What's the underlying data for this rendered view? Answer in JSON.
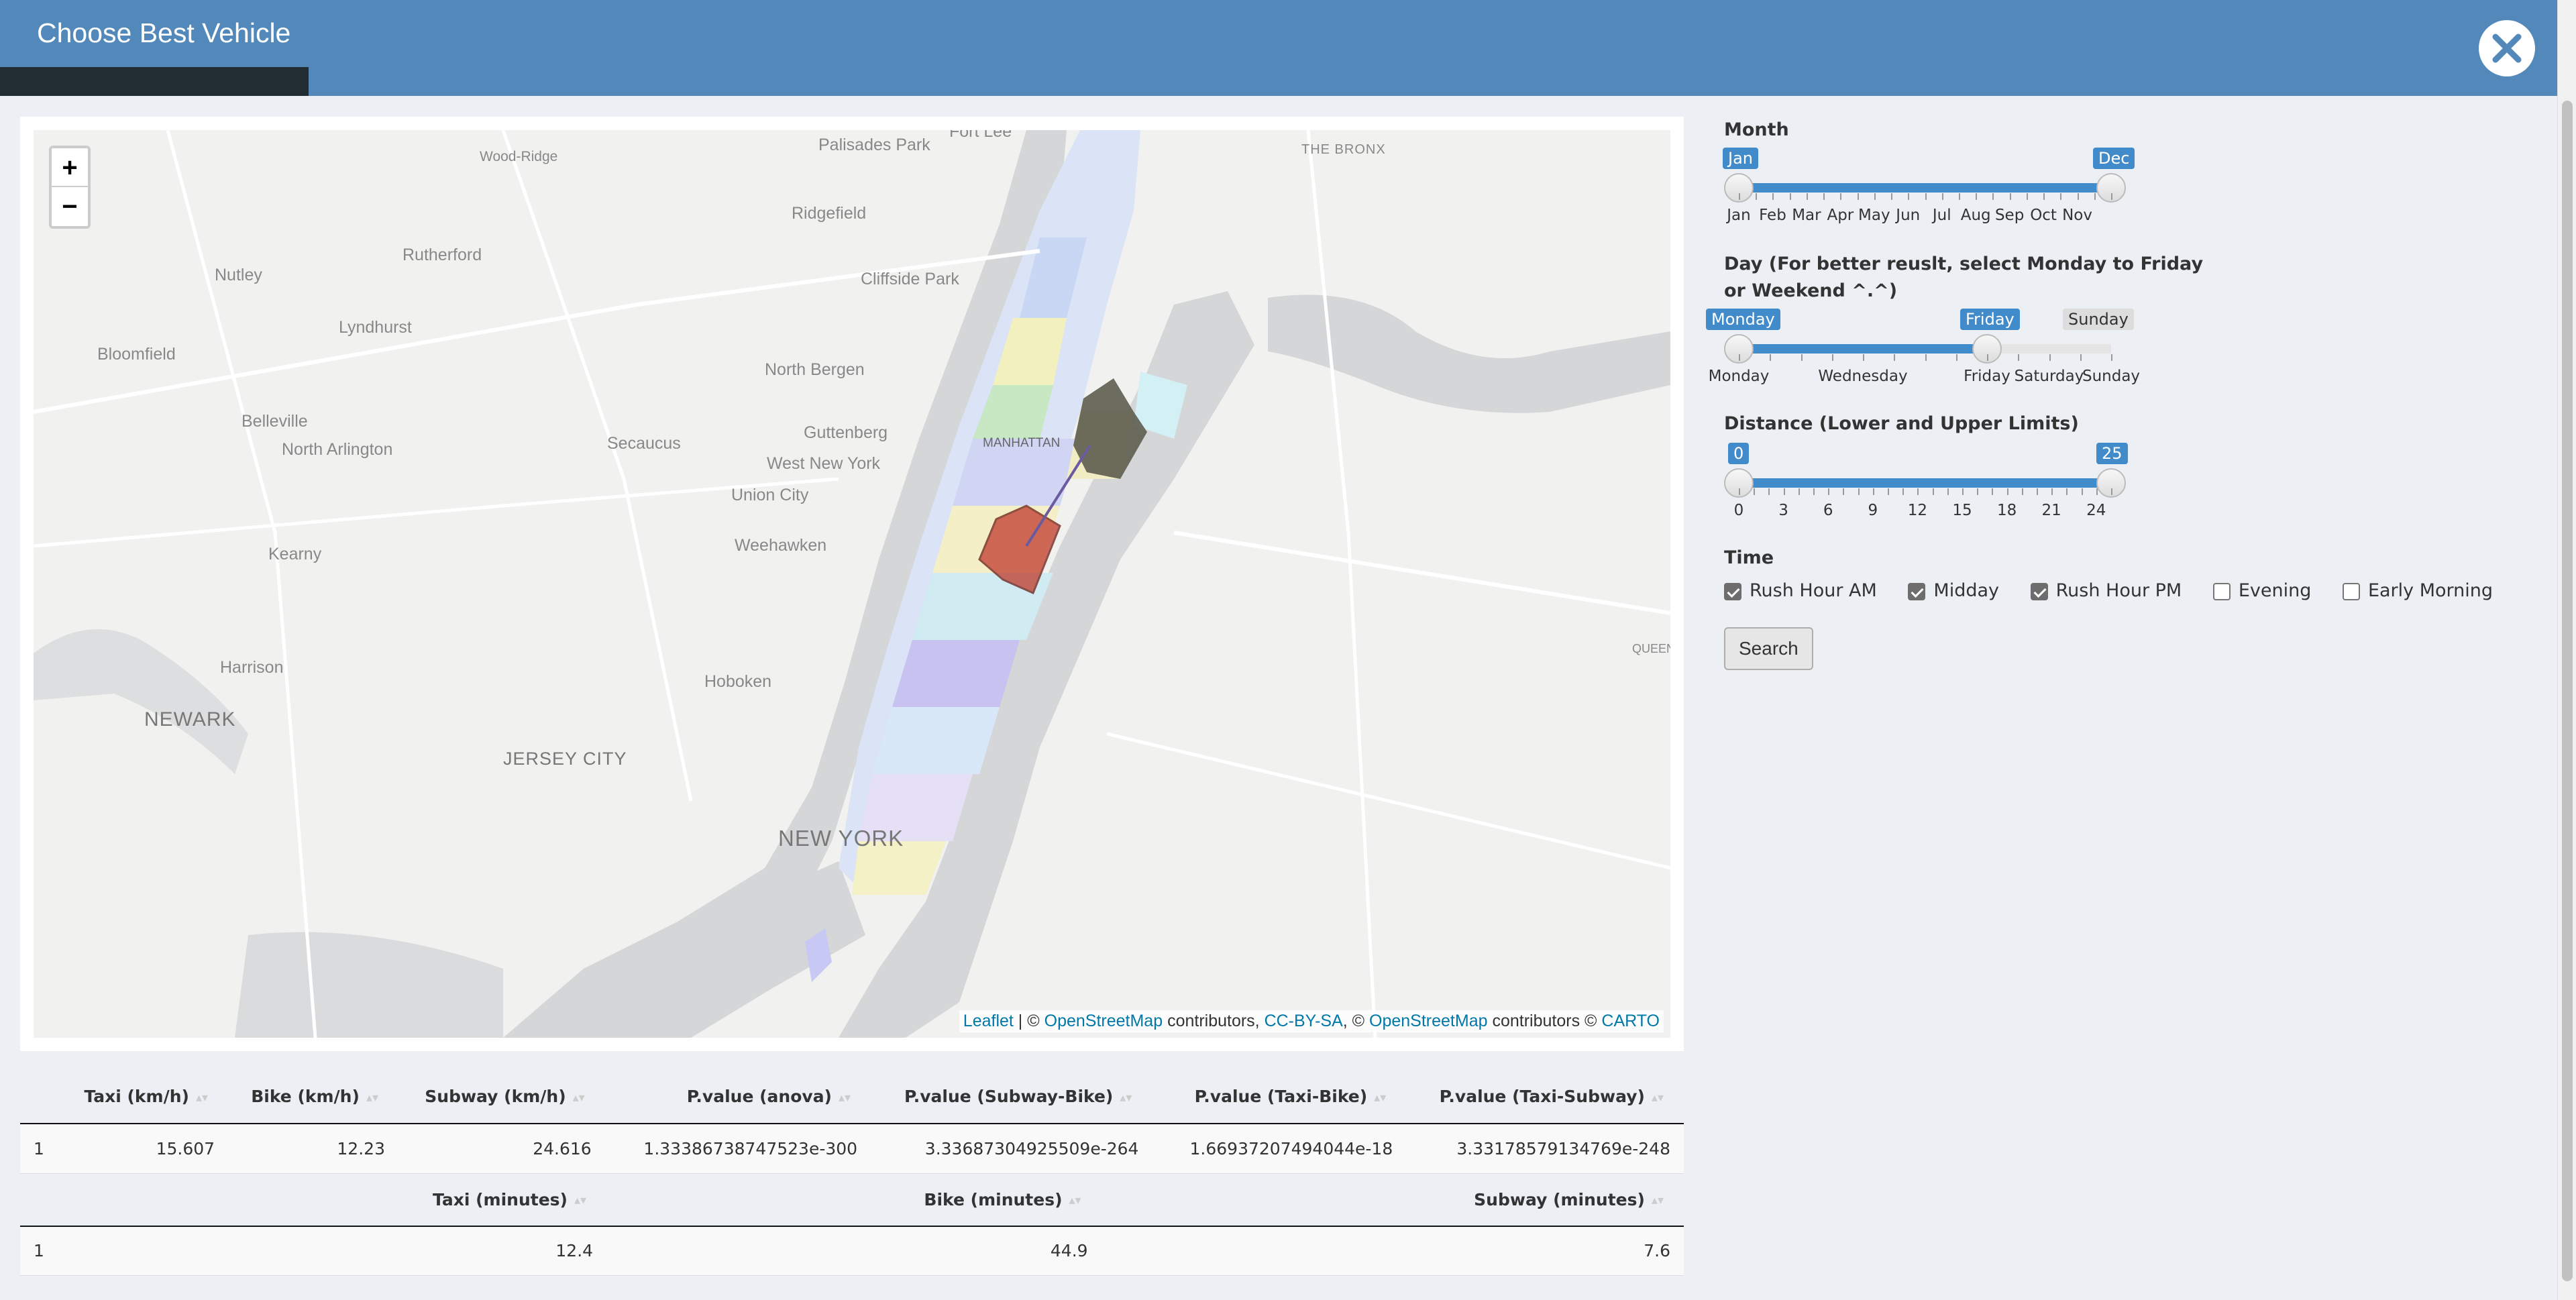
{
  "header": {
    "title": "Choose Best Vehicle",
    "close_icon": "close-icon"
  },
  "map": {
    "zoom_in": "+",
    "zoom_out": "−",
    "labels": {
      "fort_lee": "Fort Lee",
      "palisades_park": "Palisades Park",
      "the_bronx": "THE BRONX",
      "wood_ridge": "Wood-Ridge",
      "ridgefield": "Ridgefield",
      "rutherford": "Rutherford",
      "nutley": "Nutley",
      "cliffside_park": "Cliffside Park",
      "lyndhurst": "Lyndhurst",
      "bloomfield": "Bloomfield",
      "north_bergen": "North Bergen",
      "belleville": "Belleville",
      "north_arlington": "North Arlington",
      "secaucus": "Secaucus",
      "guttenberg": "Guttenberg",
      "manhattan": "MANHATTAN",
      "west_new_york": "West New York",
      "union_city": "Union City",
      "weehawken": "Weehawken",
      "kearny": "Kearny",
      "harrison": "Harrison",
      "newark": "NEWARK",
      "hoboken": "Hoboken",
      "jersey_city": "JERSEY CITY",
      "new_york": "NEW YORK",
      "queens": "QUEEN"
    },
    "attribution": {
      "leaflet": "Leaflet",
      "sep1": " | © ",
      "osm1": "OpenStreetMap",
      "mid1": " contributors, ",
      "ccbysa": "CC-BY-SA",
      "mid2": ", © ",
      "osm2": "OpenStreetMap",
      "mid3": " contributors © ",
      "carto": "CARTO"
    }
  },
  "controls": {
    "month": {
      "label": "Month",
      "from": "Jan",
      "to": "Dec",
      "ticks": [
        "Jan",
        "Feb",
        "Mar",
        "Apr",
        "May",
        "Jun",
        "Jul",
        "Aug",
        "Sep",
        "Oct",
        "Nov"
      ]
    },
    "day": {
      "label_line1": "Day (For better reuslt, select Monday to Friday",
      "label_line2": "or Weekend ^.^)",
      "from": "Monday",
      "to": "Friday",
      "max": "Sunday",
      "ticks": [
        "Monday",
        "Wednesday",
        "Friday",
        "Saturday",
        "Sunday"
      ]
    },
    "distance": {
      "label": "Distance (Lower and Upper Limits)",
      "from": "0",
      "to": "25",
      "ticks": [
        "0",
        "3",
        "6",
        "9",
        "12",
        "15",
        "18",
        "21",
        "24"
      ]
    },
    "time": {
      "label": "Time",
      "options": [
        {
          "label": "Rush Hour AM",
          "checked": true
        },
        {
          "label": "Midday",
          "checked": true
        },
        {
          "label": "Rush Hour PM",
          "checked": true
        },
        {
          "label": "Evening",
          "checked": false
        },
        {
          "label": "Early Morning",
          "checked": false
        }
      ]
    },
    "search_label": "Search"
  },
  "table1": {
    "headers": [
      "",
      "Taxi (km/h)",
      "Bike (km/h)",
      "Subway (km/h)",
      "P.value (anova)",
      "P.value (Subway-Bike)",
      "P.value (Taxi-Bike)",
      "P.value (Taxi-Subway)"
    ],
    "rows": [
      [
        "1",
        "15.607",
        "12.23",
        "24.616",
        "1.33386738747523e-300",
        "3.33687304925509e-264",
        "1.66937207494044e-18",
        "3.33178579134769e-248"
      ]
    ]
  },
  "table2": {
    "headers": [
      "",
      "Taxi (minutes)",
      "Bike (minutes)",
      "Subway (minutes)"
    ],
    "rows": [
      [
        "1",
        "12.4",
        "44.9",
        "7.6"
      ]
    ]
  }
}
